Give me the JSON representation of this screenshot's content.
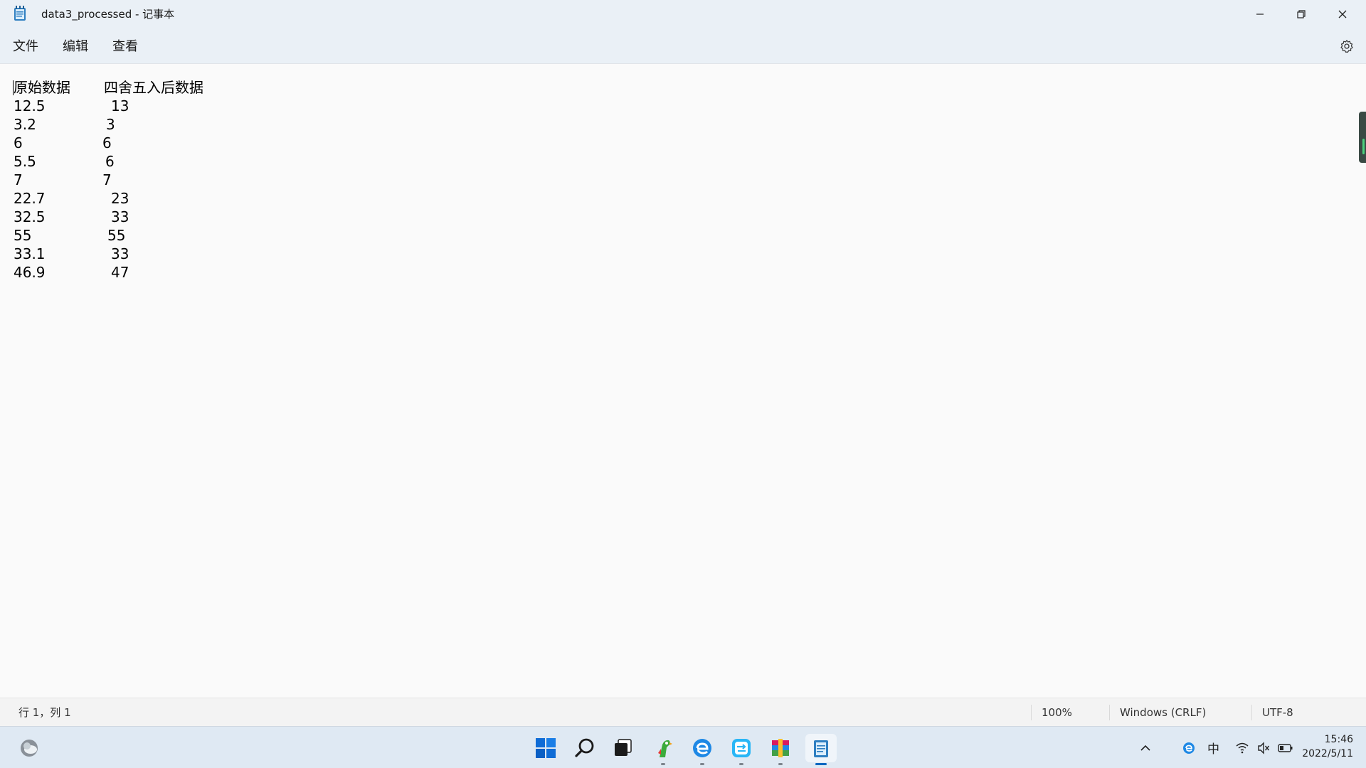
{
  "window": {
    "title": "data3_processed - 记事本"
  },
  "menu": {
    "file": "文件",
    "edit": "编辑",
    "view": "查看"
  },
  "editor": {
    "header": [
      "原始数据",
      "四舍五入后数据"
    ],
    "rows": [
      [
        "12.5",
        "13"
      ],
      [
        "3.2",
        "3"
      ],
      [
        "6",
        "6"
      ],
      [
        "5.5",
        "6"
      ],
      [
        "7",
        "7"
      ],
      [
        "22.7",
        "23"
      ],
      [
        "32.5",
        "33"
      ],
      [
        "55",
        "55"
      ],
      [
        "33.1",
        "33"
      ],
      [
        "46.9",
        "47"
      ]
    ]
  },
  "status": {
    "position": "行 1，列 1",
    "zoom": "100%",
    "line_ending": "Windows (CRLF)",
    "encoding": "UTF-8"
  },
  "taskbar": {
    "apps": [
      "widgets-icon",
      "start-icon",
      "search-icon",
      "task-view-icon",
      "parrot-app-icon",
      "browser-icon",
      "transfer-app-icon",
      "archive-app-icon",
      "notepad-icon"
    ]
  },
  "tray": {
    "ime": "中",
    "time": "15:46",
    "date": "2022/5/11"
  },
  "colors": {
    "accent": "#0067c0",
    "titlebar": "#eaf0f6",
    "taskbar": "#dfe9f3"
  }
}
